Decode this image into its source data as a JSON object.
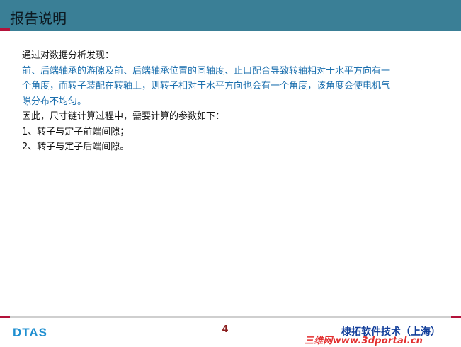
{
  "header": {
    "title": "报告说明"
  },
  "body": {
    "intro": "通过对数据分析发现：",
    "finding": "前、后端轴承的游隙及前、后端轴承位置的同轴度、止口配合导致转轴相对于水平方向有一个角度，而转子装配在转轴上，则转子相对于水平方向也会有一个角度，该角度会使电机气隙分布不均匀。",
    "finding_lines": [
      "前、后端轴承的游隙及前、后端轴承位置的同轴度、止口配合导致转轴相对于水平方向有一",
      "个角度，而转子装配在转轴上，则转子相对于水平方向也会有一个角度，该角度会使电机气",
      "隙分布不均匀。"
    ],
    "conclusion": "因此，尺寸链计算过程中，需要计算的参数如下：",
    "items": [
      "1、转子与定子前端间隙；",
      "2、转子与定子后端间隙。"
    ]
  },
  "footer": {
    "logo_text": "DTAS",
    "page_number": "4",
    "company": "棣拓软件技术（上海）",
    "watermark": "三维网www.3dportal.cn"
  },
  "colors": {
    "header_bg": "#3a7f96",
    "accent": "#b3123a",
    "highlight_text": "#1b6fae",
    "company_text": "#123e9a"
  }
}
